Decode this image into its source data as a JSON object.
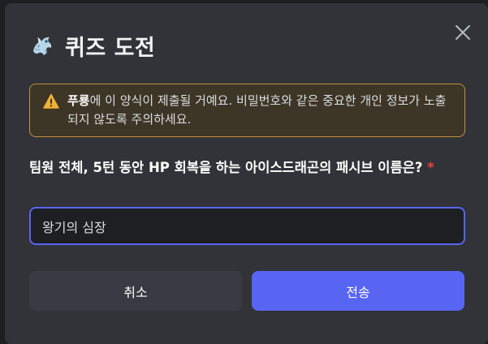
{
  "modal": {
    "title": "퀴즈 도전",
    "title_icon": "ice-dragon-icon",
    "close_icon": "close-icon"
  },
  "notice": {
    "icon": "warning-icon",
    "bold_name": "푸룡",
    "text_after_name": "에 이 양식이 제출될 거예요. 비밀번호와 같은 중요한 개인 정보가 노출되지 않도록 주의하세요."
  },
  "question": {
    "label": "팀원 전체, 5턴 동안 HP 회복을 하는 아이스드래곤의 패시브 이름은?",
    "required_marker": "*"
  },
  "answer": {
    "value": "왕기의 심장"
  },
  "buttons": {
    "cancel_label": "취소",
    "submit_label": "전송"
  },
  "colors": {
    "accent": "#5865f2",
    "warning_border": "#c2913a",
    "warning_icon": "#f0b232",
    "required": "#f23f43"
  }
}
